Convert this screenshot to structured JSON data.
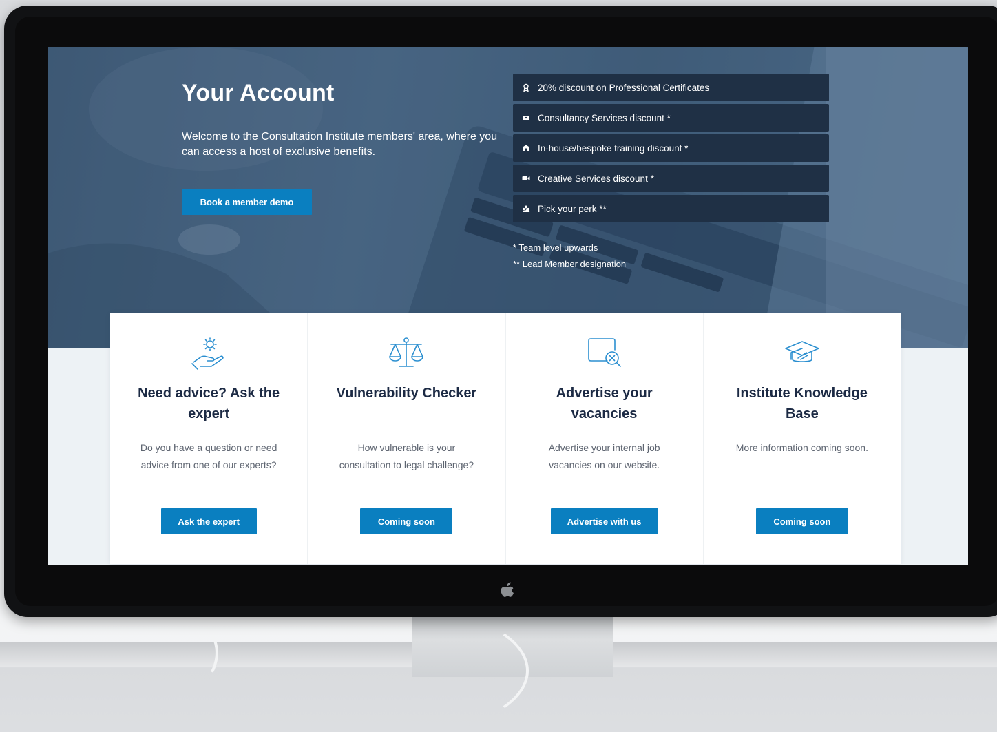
{
  "hero": {
    "title": "Your Account",
    "intro": "Welcome to the Consultation Institute members' area, where you can access a host of exclusive benefits.",
    "demo_button": "Book a member demo"
  },
  "benefits": [
    {
      "label": "20% discount on Professional Certificates",
      "icon": "award-icon"
    },
    {
      "label": "Consultancy Services discount *",
      "icon": "ticket-icon"
    },
    {
      "label": "In-house/bespoke training discount *",
      "icon": "building-icon"
    },
    {
      "label": "Creative Services discount *",
      "icon": "video-camera-icon"
    },
    {
      "label": "Pick your perk **",
      "icon": "users-icon"
    }
  ],
  "notes": {
    "team": "* Team level upwards",
    "lead": "** Lead Member designation"
  },
  "cards": [
    {
      "title": "Need advice? Ask the expert",
      "text": "Do you have a question or need advice from one of our experts?",
      "button": "Ask the expert",
      "icon": "hand-gear-icon"
    },
    {
      "title": "Vulnerability Checker",
      "text": "How vulnerable is your consultation to legal challenge?",
      "button": "Coming soon",
      "icon": "scales-icon"
    },
    {
      "title": "Advertise your vacancies",
      "text": "Advertise your internal job vacancies on our website.",
      "button": "Advertise with us",
      "icon": "browser-search-icon"
    },
    {
      "title": "Institute Knowledge Base",
      "text": "More information coming soon.",
      "button": "Coming soon",
      "icon": "graduation-cap-icon"
    }
  ],
  "colors": {
    "accent": "#0a7fc0",
    "hero_bg": "#45627f",
    "benefit_bg": "#1f3045",
    "card_title": "#1c2a44",
    "icon_line": "#2b8fd0"
  }
}
